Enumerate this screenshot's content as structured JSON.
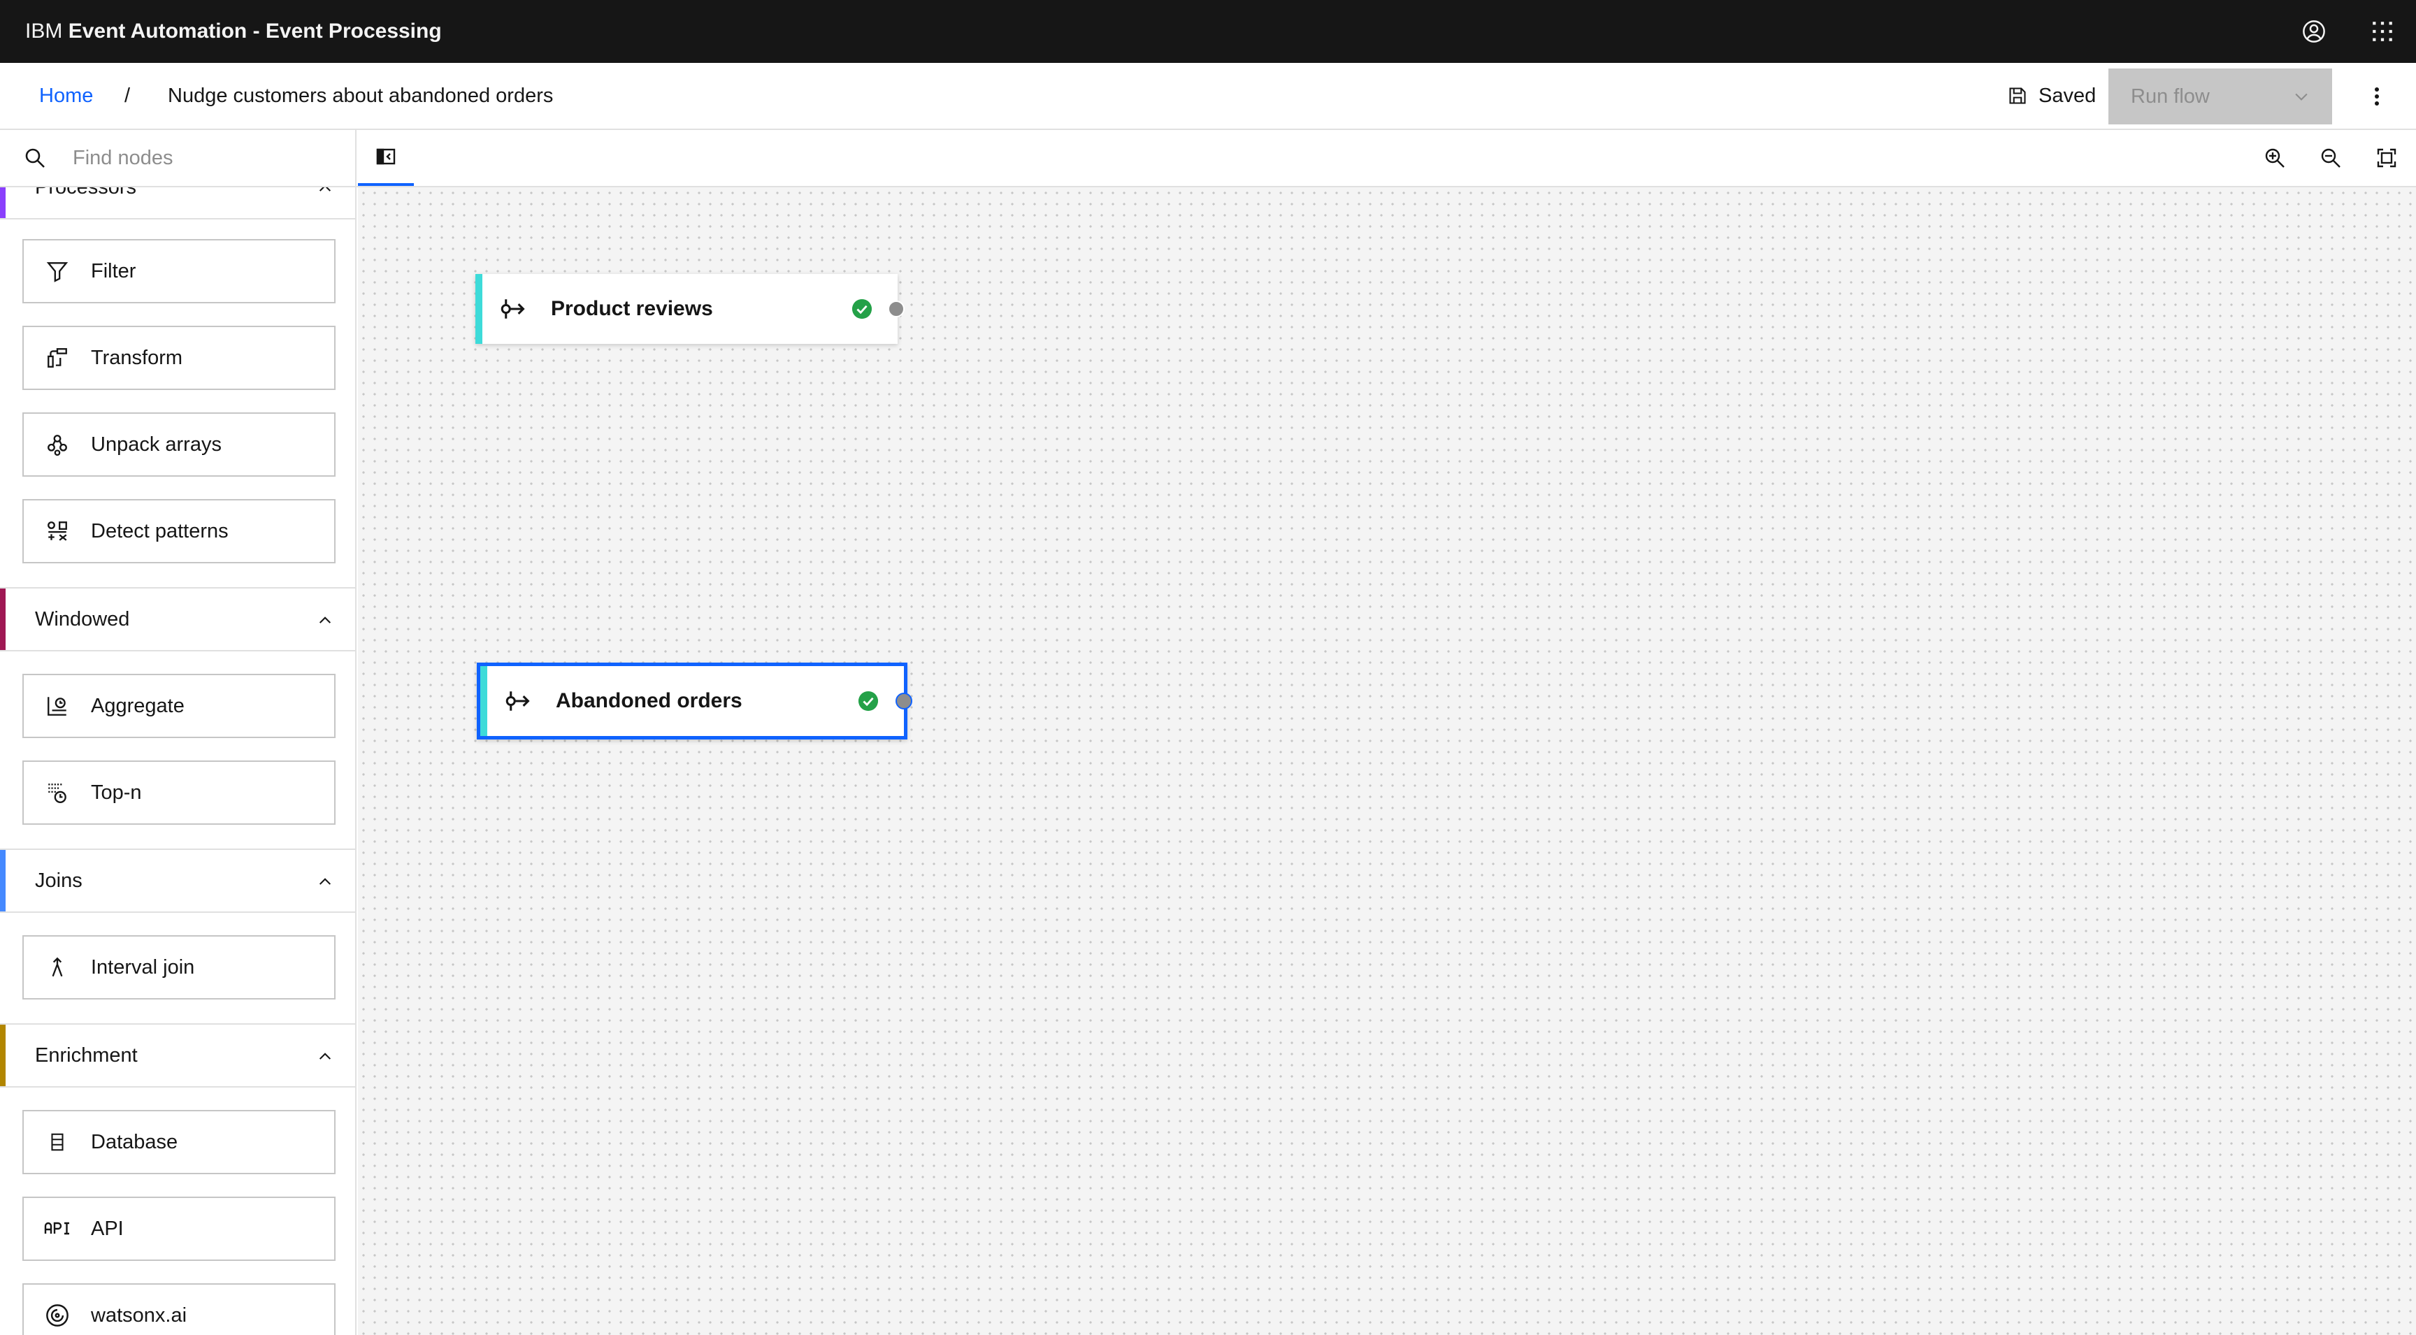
{
  "masthead": {
    "brand_prefix": "IBM",
    "brand_product": "Event Automation - Event Processing",
    "user_icon": "user-avatar-icon",
    "switcher_icon": "app-switcher-icon"
  },
  "breadcrumb": {
    "home": "Home",
    "separator": "/",
    "current": "Nudge customers about abandoned orders"
  },
  "header_actions": {
    "saved_label": "Saved",
    "run_flow_label": "Run flow",
    "overflow_icon": "overflow-menu-icon"
  },
  "toolbar": {
    "search_placeholder": "Find nodes",
    "search_value": "",
    "zoom_in_icon": "zoom-in-icon",
    "zoom_out_icon": "zoom-out-icon",
    "fit_icon": "fit-to-screen-icon"
  },
  "palette": {
    "processors": {
      "label": "Processors",
      "items": [
        {
          "label": "Filter",
          "icon": "filter-icon"
        },
        {
          "label": "Transform",
          "icon": "transform-icon"
        },
        {
          "label": "Unpack arrays",
          "icon": "unpack-arrays-icon"
        },
        {
          "label": "Detect patterns",
          "icon": "detect-patterns-icon"
        }
      ]
    },
    "windowed": {
      "label": "Windowed",
      "items": [
        {
          "label": "Aggregate",
          "icon": "aggregate-icon"
        },
        {
          "label": "Top-n",
          "icon": "top-n-icon"
        }
      ]
    },
    "joins": {
      "label": "Joins",
      "items": [
        {
          "label": "Interval join",
          "icon": "interval-join-icon"
        }
      ]
    },
    "enrichment": {
      "label": "Enrichment",
      "items": [
        {
          "label": "Database",
          "icon": "database-icon"
        },
        {
          "label": "API",
          "icon": "api-icon"
        },
        {
          "label": "watsonx.ai",
          "icon": "watsonx-icon"
        }
      ]
    },
    "colors": {
      "processors": "#8a3ffc",
      "windowed": "#9f1853",
      "joins": "#4589ff",
      "enrichment": "#b28600"
    }
  },
  "canvas": {
    "nodes": [
      {
        "label": "Product reviews",
        "status": "valid",
        "selected": false
      },
      {
        "label": "Abandoned orders",
        "status": "valid",
        "selected": true
      }
    ]
  },
  "colors": {
    "masthead_bg": "#161616",
    "link": "#0f62fe",
    "event_source_accent": "#3ddbd9",
    "success": "#24a148",
    "selection": "#0f62fe"
  }
}
